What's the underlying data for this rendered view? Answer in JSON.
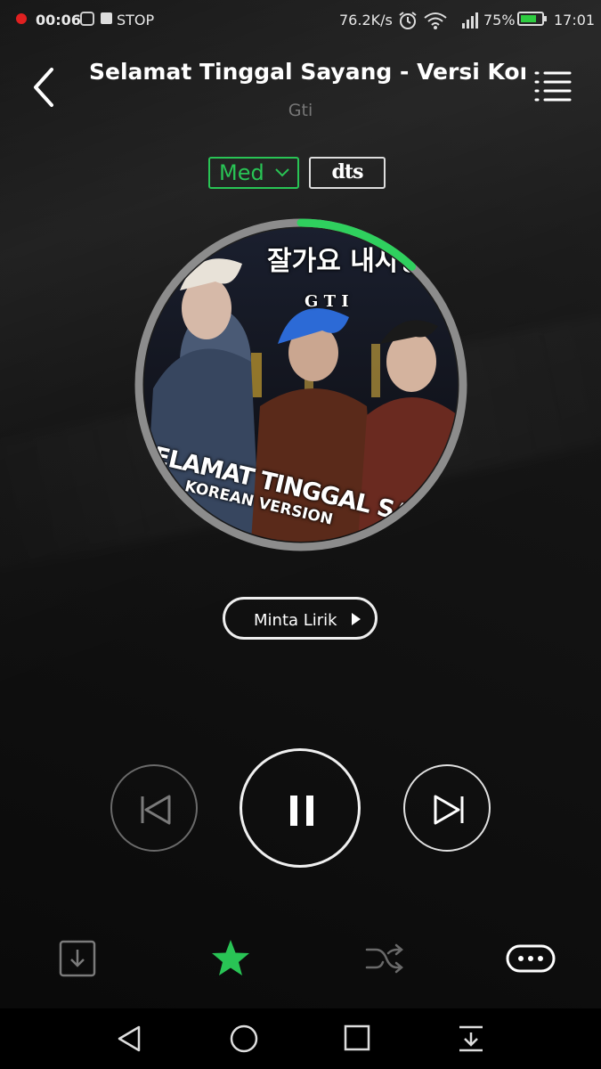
{
  "status_bar": {
    "recording_time": "00:06",
    "stop_label": "STOP",
    "net_speed": "76.2K/s",
    "battery_percent": "75%",
    "battery_level": 0.75,
    "time": "17:01"
  },
  "header": {
    "title": "Selamat Tinggal Sayang - Versi Korea",
    "artist": "Gti"
  },
  "quality": {
    "label": "Med",
    "dts_label": "dts"
  },
  "album_art": {
    "korean_title": "잘가요 내사랑",
    "band": "G T I",
    "title_text": "SELAMAT TINGGAL SAYANG",
    "subtitle_text": "KOREAN VERSION"
  },
  "playback": {
    "progress": 0.12
  },
  "lyrics_button": {
    "label": "Minta Lirik"
  },
  "icons": {
    "back": "chevron-left-icon",
    "playlist": "playlist-icon",
    "prev": "skip-previous-icon",
    "pause": "pause-icon",
    "next": "skip-next-icon",
    "download": "download-icon",
    "favorite": "star-icon",
    "shuffle": "shuffle-icon",
    "more": "more-icon"
  },
  "colors": {
    "accent": "#29c455",
    "background": "#0b0b0b",
    "progress": "#2fd05e"
  }
}
